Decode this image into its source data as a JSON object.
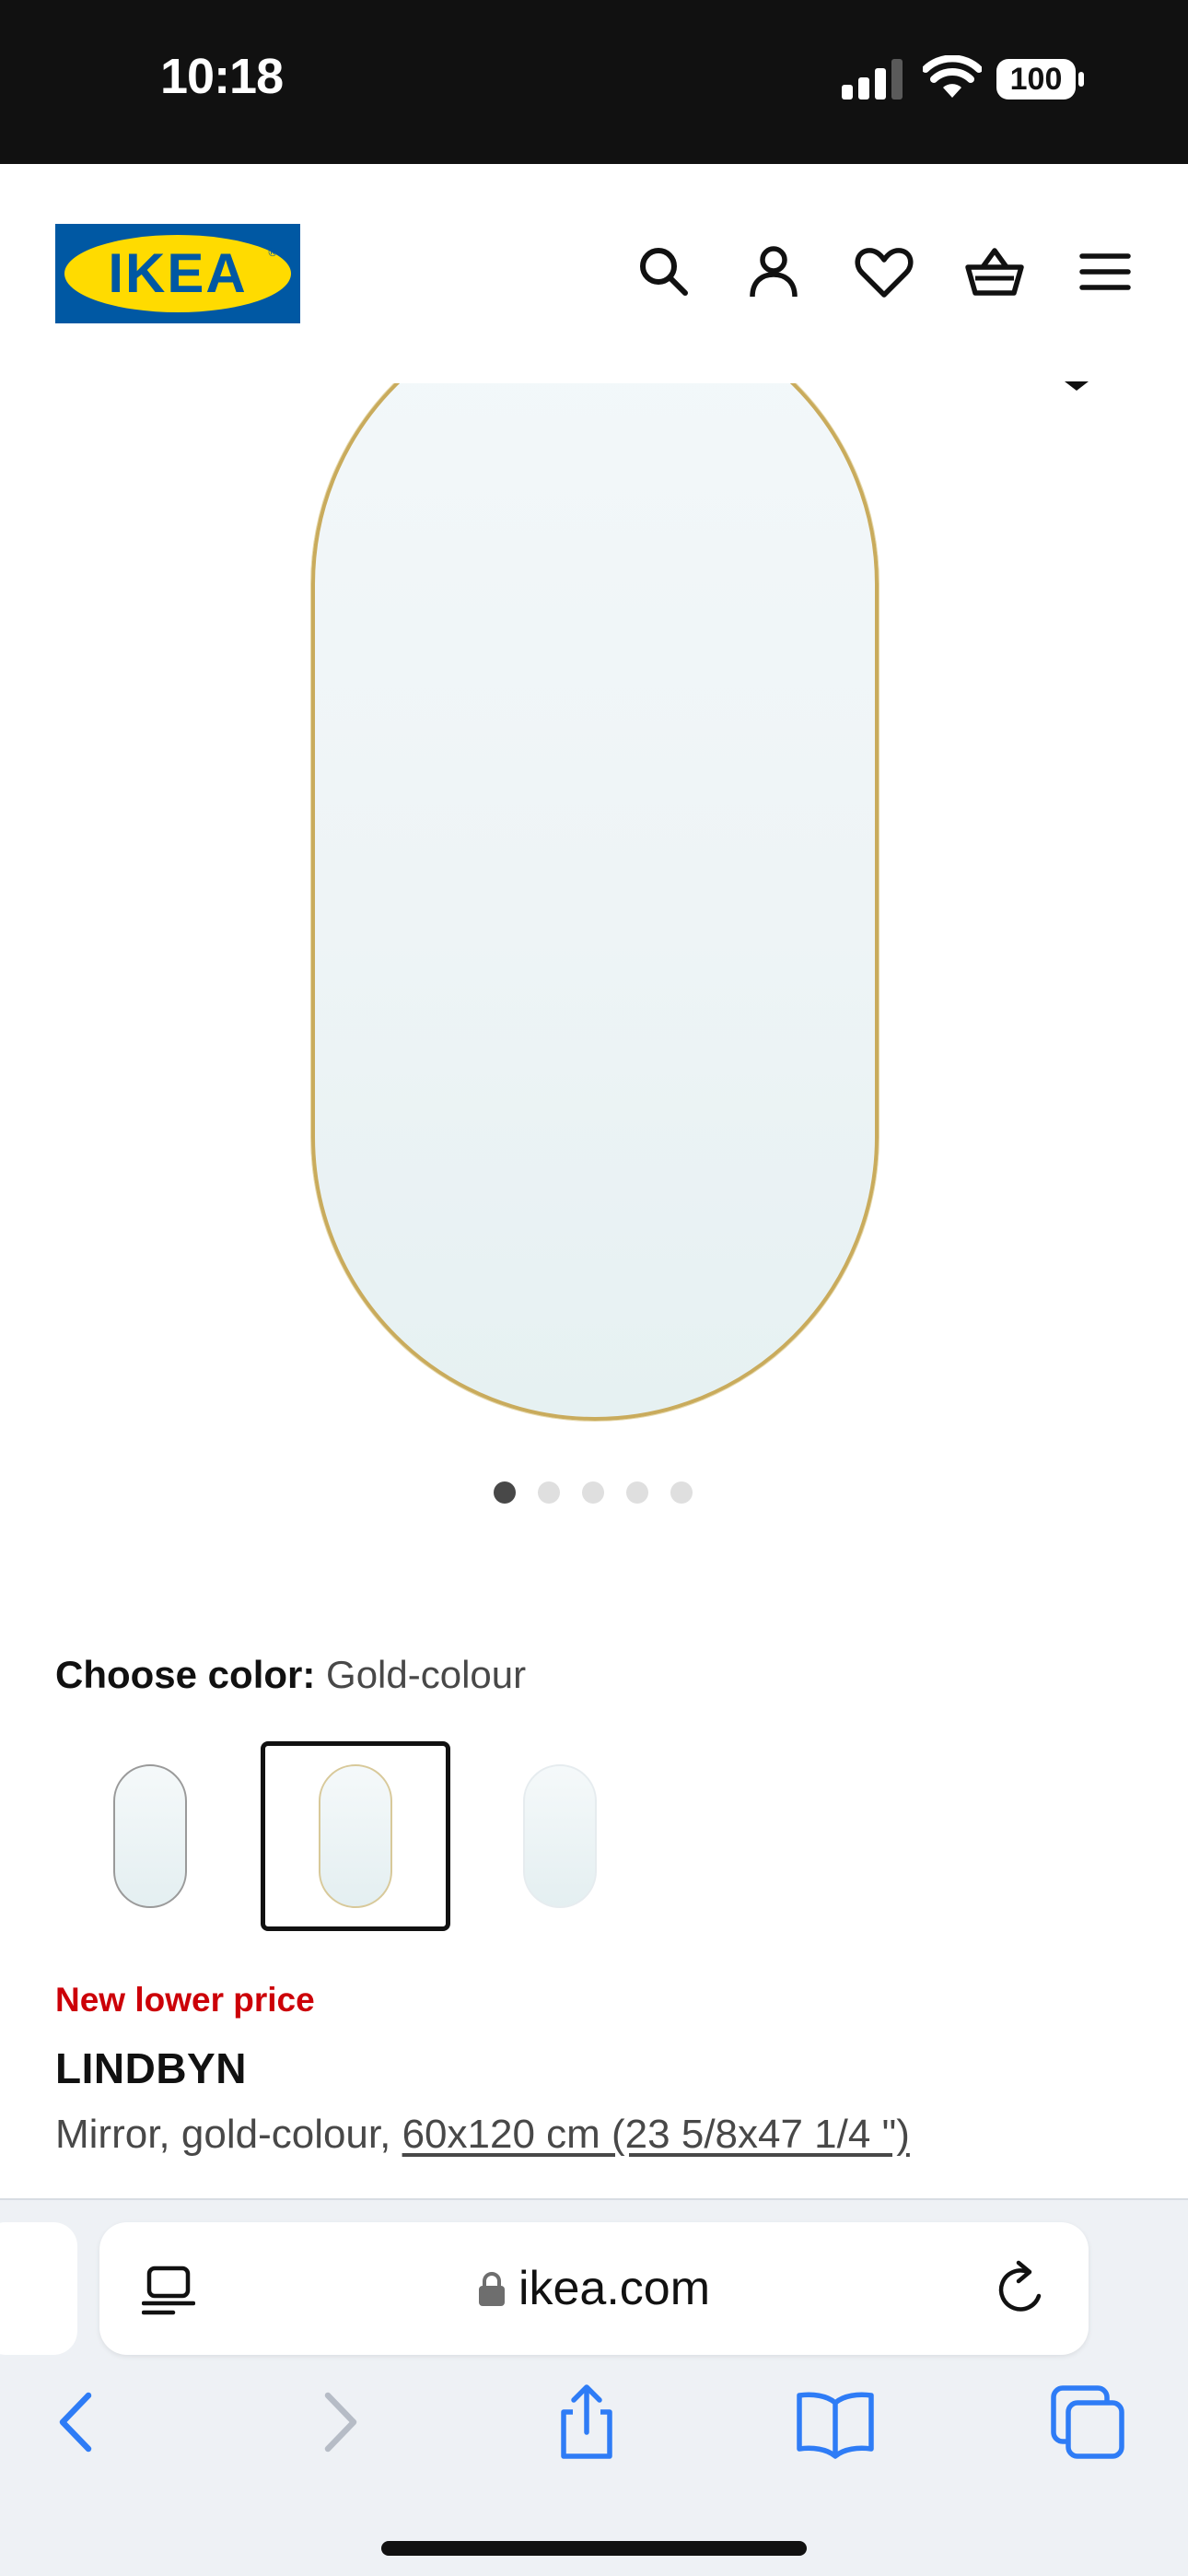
{
  "status_bar": {
    "time": "10:18",
    "battery": "100"
  },
  "header": {
    "logo_text": "IKEA",
    "logo_mark": "®",
    "icons": [
      "search-icon",
      "account-icon",
      "heart-icon",
      "basket-icon",
      "menu-icon"
    ]
  },
  "gallery": {
    "total_images": 5,
    "active_index": 0
  },
  "color_selector": {
    "label": "Choose color:",
    "selected_value": "Gold-colour",
    "selected_index": 1,
    "swatch_count": 3
  },
  "product": {
    "badge": "New lower price",
    "name": "LINDBYN",
    "description_prefix": "Mirror, gold-colour, ",
    "size_link": "60x120 cm (23 5/8x47 1/4 \")"
  },
  "browser": {
    "url": "ikea.com",
    "toolbar_icons": [
      "back-icon",
      "forward-icon",
      "share-icon",
      "bookmarks-icon",
      "tabs-icon"
    ]
  },
  "colors": {
    "ikea_blue": "#0058a3",
    "ikea_yellow": "#ffdb00",
    "badge_red": "#cc0008",
    "safari_blue": "#2e7cf6",
    "mirror_frame_gold": "#c9ab5c"
  }
}
